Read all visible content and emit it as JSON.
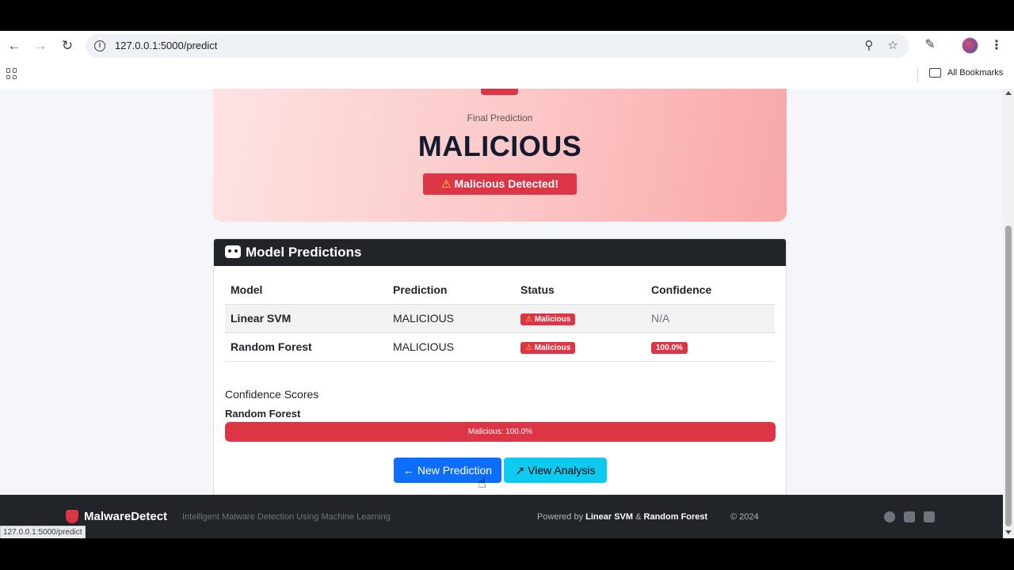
{
  "browser": {
    "url": "127.0.0.1:5000/predict",
    "bookmarks_label": "All Bookmarks",
    "status_url": "127.0.0.1:5000/predict"
  },
  "hero": {
    "label": "Final Prediction",
    "value": "MALICIOUS",
    "alert": "Malicious Detected!"
  },
  "card": {
    "title": "Model Predictions",
    "columns": [
      "Model",
      "Prediction",
      "Status",
      "Confidence"
    ],
    "rows": [
      {
        "model": "Linear SVM",
        "prediction": "MALICIOUS",
        "status": "Malicious",
        "confidence": "N/A"
      },
      {
        "model": "Random Forest",
        "prediction": "MALICIOUS",
        "status": "Malicious",
        "confidence": "100.0%"
      }
    ],
    "confidence_title": "Confidence Scores",
    "confidence_model": "Random Forest",
    "progress_label": "Malicious: 100.0%",
    "progress_value": 1.0,
    "new_prediction": "New Prediction",
    "view_analysis": "View Analysis"
  },
  "footer": {
    "brand": "MalwareDetect",
    "tagline": "Intelligent Malware Detection Using Machine Learning",
    "powered_prefix": "Powered by",
    "model_a": "Linear SVM",
    "amp": "&",
    "model_b": "Random Forest",
    "copyright": "© 2024"
  },
  "colors": {
    "danger": "#dc3545",
    "primary": "#0d6efd",
    "info": "#0dcaf0",
    "dark": "#212529"
  },
  "icons": [
    "back-arrow-icon",
    "forward-arrow-icon",
    "reload-icon",
    "info-icon",
    "zoom-icon",
    "star-icon",
    "extensions-icon",
    "menu-icon",
    "apps-icon",
    "folder-icon",
    "shield-icon",
    "robot-icon",
    "warning-icon",
    "arrow-left-icon",
    "chart-line-icon",
    "github-icon",
    "twitter-icon",
    "linkedin-icon"
  ]
}
